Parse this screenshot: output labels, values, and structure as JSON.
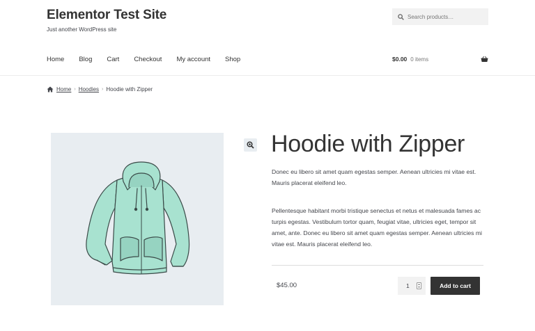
{
  "site": {
    "title": "Elementor Test Site",
    "tagline": "Just another WordPress site"
  },
  "search": {
    "placeholder": "Search products…"
  },
  "nav": {
    "items": [
      "Home",
      "Blog",
      "Cart",
      "Checkout",
      "My account",
      "Shop"
    ]
  },
  "cart": {
    "amount": "$0.00",
    "count": "0 items"
  },
  "breadcrumb": {
    "items": [
      "Home",
      "Hoodies",
      "Hoodie with Zipper"
    ]
  },
  "product": {
    "title": "Hoodie with Zipper",
    "short_description": "Donec eu libero sit amet quam egestas semper. Aenean ultricies mi vitae est. Mauris placerat eleifend leo.",
    "long_description": "Pellentesque habitant morbi tristique senectus et netus et malesuada fames ac turpis egestas. Vestibulum tortor quam, feugiat vitae, ultricies eget, tempor sit amet, ante. Donec eu libero sit amet quam egestas semper. Aenean ultricies mi vitae est. Mauris placerat eleifend leo.",
    "price": "$45.00",
    "quantity": "1",
    "add_to_cart_label": "Add to cart"
  },
  "colors": {
    "accent": "#333333",
    "image_background": "#e8edf1",
    "hoodie": "#a8e2d0"
  }
}
